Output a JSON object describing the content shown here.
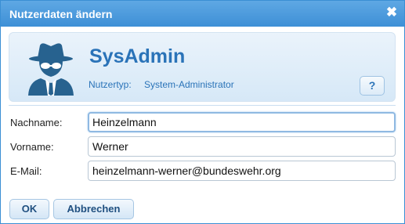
{
  "dialog": {
    "title": "Nutzerdaten ändern",
    "close_glyph": "✖"
  },
  "profile": {
    "avatar_icon": "agent-avatar-icon",
    "name": "SysAdmin",
    "usertype_label": "Nutzertyp:",
    "usertype_value": "System-Administrator",
    "help_label": "?"
  },
  "form": {
    "lastname_label": "Nachname:",
    "lastname_value": "Heinzelmann",
    "firstname_label": "Vorname:",
    "firstname_value": "Werner",
    "email_label": "E-Mail:",
    "email_value": "heinzelmann-werner@bundeswehr.org"
  },
  "buttons": {
    "ok_label": "OK",
    "cancel_label": "Abbrechen"
  },
  "colors": {
    "titlebar": "#3d8fd6",
    "accent_text": "#2a73b8",
    "panel_bg": "#d6e8f7"
  }
}
